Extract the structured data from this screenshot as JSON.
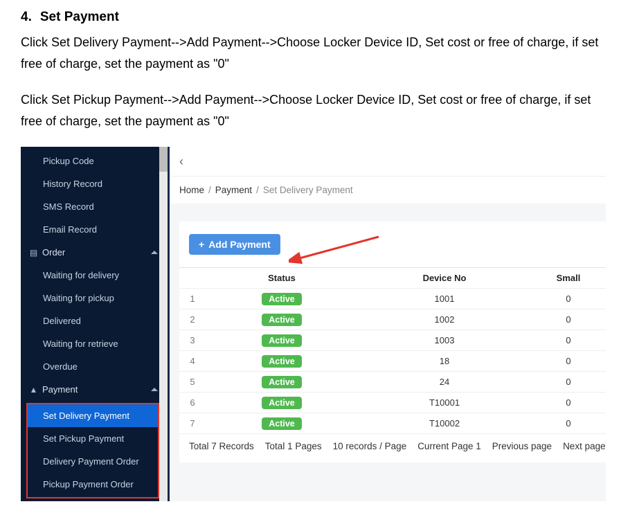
{
  "doc": {
    "heading_num": "4.",
    "heading_text": "Set Payment",
    "para1": "Click Set Delivery Payment-->Add Payment-->Choose Locker Device ID, Set cost or free of charge, if set free of charge, set the payment as \"0\"",
    "para2": "Click Set Pickup Payment-->Add Payment-->Choose Locker Device ID, Set cost or free of charge, if set free of charge, set the payment as \"0\""
  },
  "sidebar": {
    "pickup_code": "Pickup Code",
    "history_record": "History Record",
    "sms_record": "SMS Record",
    "email_record": "Email Record",
    "order_group": "Order",
    "order_items": {
      "waiting_delivery": "Waiting for delivery",
      "waiting_pickup": "Waiting for pickup",
      "delivered": "Delivered",
      "waiting_retrieve": "Waiting for retrieve",
      "overdue": "Overdue"
    },
    "payment_group": "Payment",
    "payment_items": {
      "set_delivery": "Set Delivery Payment",
      "set_pickup": "Set Pickup Payment",
      "delivery_order": "Delivery Payment Order",
      "pickup_order": "Pickup Payment Order"
    }
  },
  "breadcrumb": {
    "home": "Home",
    "payment": "Payment",
    "current": "Set Delivery Payment"
  },
  "add_button": "Add Payment",
  "chart_data": {
    "type": "table",
    "columns": [
      "",
      "Status",
      "Device No",
      "Small"
    ],
    "rows": [
      {
        "idx": "1",
        "status": "Active",
        "device": "1001",
        "small": "0"
      },
      {
        "idx": "2",
        "status": "Active",
        "device": "1002",
        "small": "0"
      },
      {
        "idx": "3",
        "status": "Active",
        "device": "1003",
        "small": "0"
      },
      {
        "idx": "4",
        "status": "Active",
        "device": "18",
        "small": "0"
      },
      {
        "idx": "5",
        "status": "Active",
        "device": "24",
        "small": "0"
      },
      {
        "idx": "6",
        "status": "Active",
        "device": "T10001",
        "small": "0"
      },
      {
        "idx": "7",
        "status": "Active",
        "device": "T10002",
        "small": "0"
      }
    ]
  },
  "pager": {
    "total_records": "Total 7 Records",
    "total_pages": "Total 1 Pages",
    "per_page": "10 records / Page",
    "current": "Current Page 1",
    "prev": "Previous page",
    "next": "Next page"
  }
}
